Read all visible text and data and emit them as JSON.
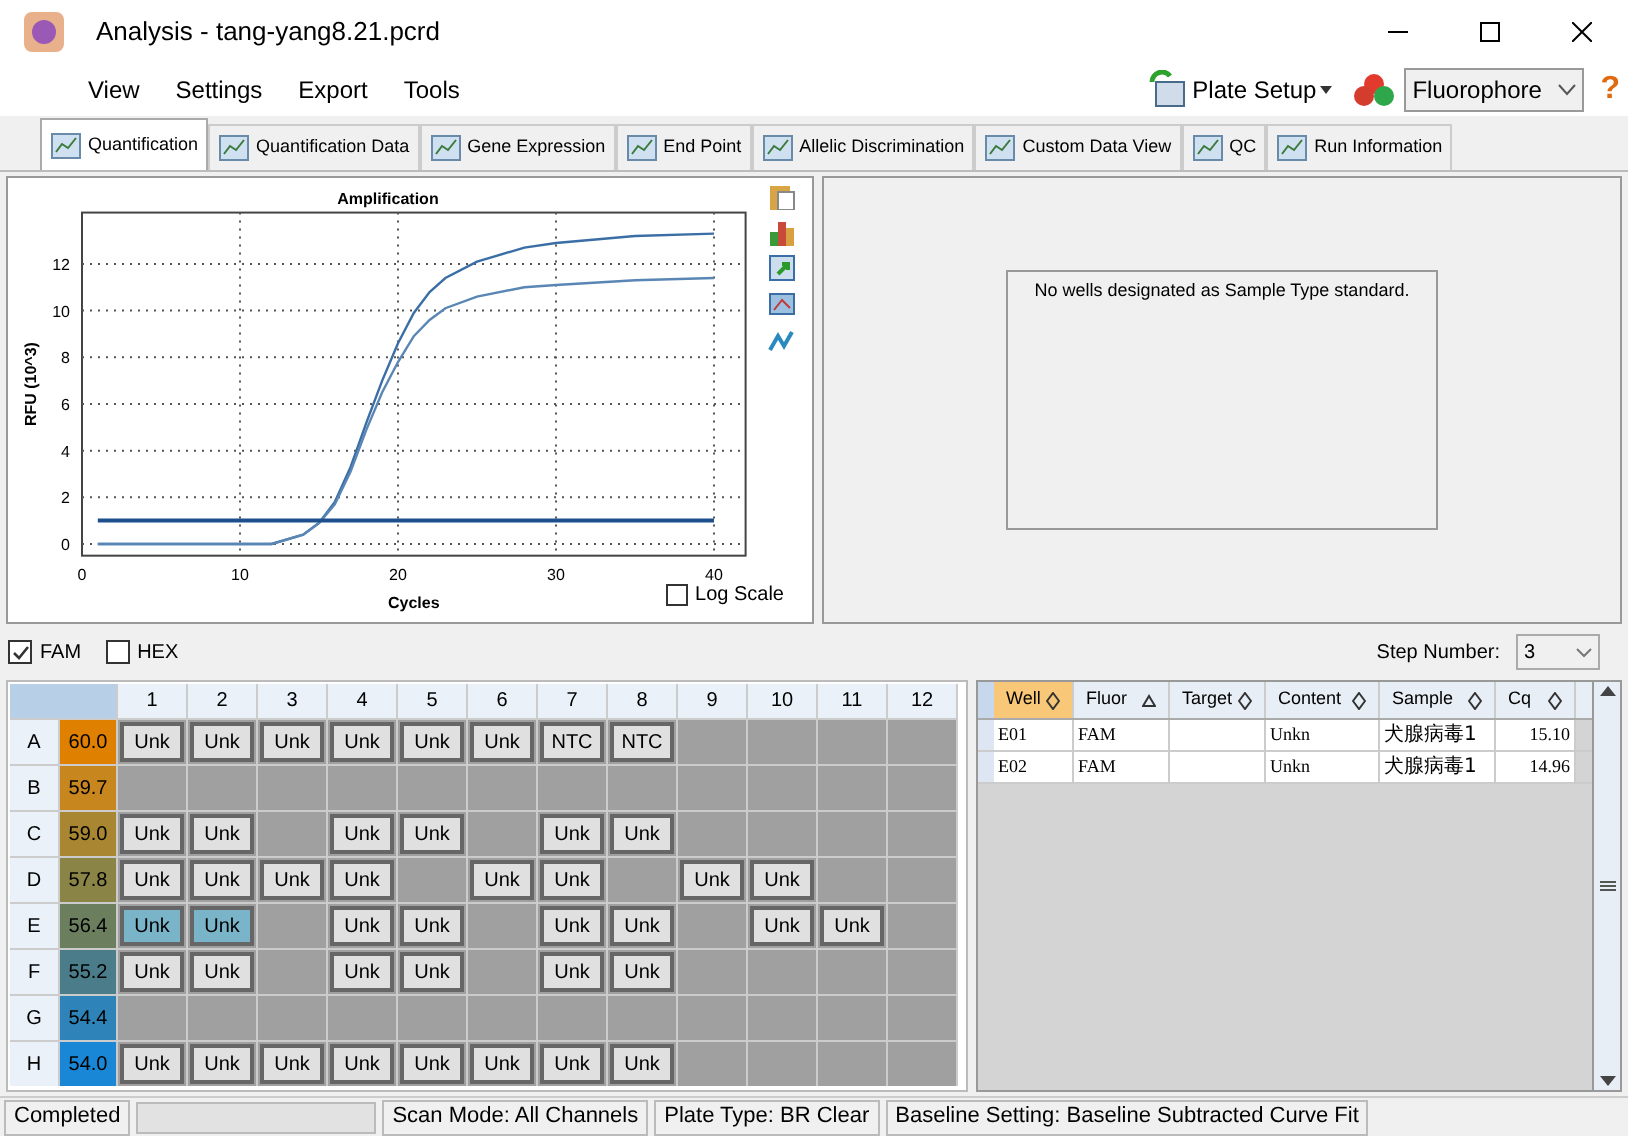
{
  "window": {
    "title": "Analysis - tang-yang8.21.pcrd"
  },
  "menu": [
    "View",
    "Settings",
    "Export",
    "Tools"
  ],
  "toolbar": {
    "plate_setup": "Plate Setup",
    "fluorophore": "Fluorophore",
    "help": "?"
  },
  "tabs": [
    {
      "label": "Quantification",
      "selected": true
    },
    {
      "label": "Quantification Data",
      "selected": false
    },
    {
      "label": "Gene Expression",
      "selected": false
    },
    {
      "label": "End Point",
      "selected": false
    },
    {
      "label": "Allelic Discrimination",
      "selected": false
    },
    {
      "label": "Custom Data View",
      "selected": false
    },
    {
      "label": "QC",
      "selected": false
    },
    {
      "label": "Run Information",
      "selected": false
    }
  ],
  "chart": {
    "log_scale": {
      "label": "Log Scale",
      "checked": false
    },
    "chart_data": {
      "type": "line",
      "title": "Amplification",
      "xlabel": "Cycles",
      "ylabel": "RFU (10^3)",
      "xlim": [
        0,
        42
      ],
      "ylim": [
        -0.5,
        14.2
      ],
      "xticks": [
        0,
        10,
        20,
        30,
        40
      ],
      "yticks": [
        0,
        2,
        4,
        6,
        8,
        10,
        12
      ],
      "grid": true,
      "x": [
        1,
        5,
        10,
        12,
        14,
        15,
        16,
        17,
        18,
        19,
        20,
        21,
        22,
        23,
        25,
        28,
        30,
        35,
        40
      ],
      "series": [
        {
          "color": "#3a6ea5",
          "values": [
            0,
            0,
            0,
            0,
            0.4,
            0.9,
            1.8,
            3.3,
            5.2,
            7.0,
            8.6,
            9.9,
            10.8,
            11.4,
            12.1,
            12.7,
            12.9,
            13.2,
            13.3
          ]
        },
        {
          "color": "#5a86b5",
          "values": [
            0,
            0,
            0,
            0,
            0.4,
            0.9,
            1.7,
            3.1,
            4.9,
            6.5,
            7.8,
            8.9,
            9.6,
            10.1,
            10.6,
            11.0,
            11.1,
            11.3,
            11.4
          ]
        },
        {
          "color": "#1c4f8c",
          "values": [
            1,
            1,
            1,
            1,
            1,
            1,
            1,
            1,
            1,
            1,
            1,
            1,
            1,
            1,
            1,
            1,
            1,
            1,
            1
          ]
        }
      ]
    }
  },
  "standard_message": "No wells designated as Sample Type standard.",
  "fluors": [
    {
      "label": "FAM",
      "checked": true
    },
    {
      "label": "HEX",
      "checked": false
    }
  ],
  "step": {
    "label": "Step Number:",
    "value": "3"
  },
  "plate": {
    "columns": [
      "1",
      "2",
      "3",
      "4",
      "5",
      "6",
      "7",
      "8",
      "9",
      "10",
      "11",
      "12"
    ],
    "rows": [
      {
        "label": "A",
        "temp": "60.0",
        "color": "#e08000",
        "wells": [
          {
            "kind": "sample",
            "label": "Unk",
            "selected": false
          },
          {
            "kind": "sample",
            "label": "Unk",
            "selected": false
          },
          {
            "kind": "sample",
            "label": "Unk",
            "selected": false
          },
          {
            "kind": "sample",
            "label": "Unk",
            "selected": false
          },
          {
            "kind": "sample",
            "label": "Unk",
            "selected": false
          },
          {
            "kind": "sample",
            "label": "Unk",
            "selected": false
          },
          {
            "kind": "sample",
            "label": "NTC",
            "selected": false
          },
          {
            "kind": "sample",
            "label": "NTC",
            "selected": false
          },
          {
            "kind": "empty"
          },
          {
            "kind": "empty"
          },
          {
            "kind": "empty"
          },
          {
            "kind": "empty"
          }
        ]
      },
      {
        "label": "B",
        "temp": "59.7",
        "color": "#c8861e",
        "wells": [
          {
            "kind": "empty"
          },
          {
            "kind": "empty"
          },
          {
            "kind": "empty"
          },
          {
            "kind": "empty"
          },
          {
            "kind": "empty"
          },
          {
            "kind": "empty"
          },
          {
            "kind": "empty"
          },
          {
            "kind": "empty"
          },
          {
            "kind": "empty"
          },
          {
            "kind": "empty"
          },
          {
            "kind": "empty"
          },
          {
            "kind": "empty"
          }
        ]
      },
      {
        "label": "C",
        "temp": "59.0",
        "color": "#a98632",
        "wells": [
          {
            "kind": "sample",
            "label": "Unk",
            "selected": false
          },
          {
            "kind": "sample",
            "label": "Unk",
            "selected": false
          },
          {
            "kind": "empty"
          },
          {
            "kind": "sample",
            "label": "Unk",
            "selected": false
          },
          {
            "kind": "sample",
            "label": "Unk",
            "selected": false
          },
          {
            "kind": "empty"
          },
          {
            "kind": "sample",
            "label": "Unk",
            "selected": false
          },
          {
            "kind": "sample",
            "label": "Unk",
            "selected": false
          },
          {
            "kind": "empty"
          },
          {
            "kind": "empty"
          },
          {
            "kind": "empty"
          },
          {
            "kind": "empty"
          }
        ]
      },
      {
        "label": "D",
        "temp": "57.8",
        "color": "#8a8446",
        "wells": [
          {
            "kind": "sample",
            "label": "Unk",
            "selected": false
          },
          {
            "kind": "sample",
            "label": "Unk",
            "selected": false
          },
          {
            "kind": "sample",
            "label": "Unk",
            "selected": false
          },
          {
            "kind": "sample",
            "label": "Unk",
            "selected": false
          },
          {
            "kind": "empty"
          },
          {
            "kind": "sample",
            "label": "Unk",
            "selected": false
          },
          {
            "kind": "sample",
            "label": "Unk",
            "selected": false
          },
          {
            "kind": "empty"
          },
          {
            "kind": "sample",
            "label": "Unk",
            "selected": false
          },
          {
            "kind": "sample",
            "label": "Unk",
            "selected": false
          },
          {
            "kind": "empty"
          },
          {
            "kind": "empty"
          }
        ]
      },
      {
        "label": "E",
        "temp": "56.4",
        "color": "#6b7f5e",
        "wells": [
          {
            "kind": "sample",
            "label": "Unk",
            "selected": true
          },
          {
            "kind": "sample",
            "label": "Unk",
            "selected": true
          },
          {
            "kind": "empty"
          },
          {
            "kind": "sample",
            "label": "Unk",
            "selected": false
          },
          {
            "kind": "sample",
            "label": "Unk",
            "selected": false
          },
          {
            "kind": "empty"
          },
          {
            "kind": "sample",
            "label": "Unk",
            "selected": false
          },
          {
            "kind": "sample",
            "label": "Unk",
            "selected": false
          },
          {
            "kind": "empty"
          },
          {
            "kind": "sample",
            "label": "Unk",
            "selected": false
          },
          {
            "kind": "sample",
            "label": "Unk",
            "selected": false
          },
          {
            "kind": "empty"
          }
        ]
      },
      {
        "label": "F",
        "temp": "55.2",
        "color": "#4a7c8a",
        "wells": [
          {
            "kind": "sample",
            "label": "Unk",
            "selected": false
          },
          {
            "kind": "sample",
            "label": "Unk",
            "selected": false
          },
          {
            "kind": "empty"
          },
          {
            "kind": "sample",
            "label": "Unk",
            "selected": false
          },
          {
            "kind": "sample",
            "label": "Unk",
            "selected": false
          },
          {
            "kind": "empty"
          },
          {
            "kind": "sample",
            "label": "Unk",
            "selected": false
          },
          {
            "kind": "sample",
            "label": "Unk",
            "selected": false
          },
          {
            "kind": "empty"
          },
          {
            "kind": "empty"
          },
          {
            "kind": "empty"
          },
          {
            "kind": "empty"
          }
        ]
      },
      {
        "label": "G",
        "temp": "54.4",
        "color": "#2e84b8",
        "wells": [
          {
            "kind": "empty"
          },
          {
            "kind": "empty"
          },
          {
            "kind": "empty"
          },
          {
            "kind": "empty"
          },
          {
            "kind": "empty"
          },
          {
            "kind": "empty"
          },
          {
            "kind": "empty"
          },
          {
            "kind": "empty"
          },
          {
            "kind": "empty"
          },
          {
            "kind": "empty"
          },
          {
            "kind": "empty"
          },
          {
            "kind": "empty"
          }
        ]
      },
      {
        "label": "H",
        "temp": "54.0",
        "color": "#1a86d6",
        "wells": [
          {
            "kind": "sample",
            "label": "Unk",
            "selected": false
          },
          {
            "kind": "sample",
            "label": "Unk",
            "selected": false
          },
          {
            "kind": "sample",
            "label": "Unk",
            "selected": false
          },
          {
            "kind": "sample",
            "label": "Unk",
            "selected": false
          },
          {
            "kind": "sample",
            "label": "Unk",
            "selected": false
          },
          {
            "kind": "sample",
            "label": "Unk",
            "selected": false
          },
          {
            "kind": "sample",
            "label": "Unk",
            "selected": false
          },
          {
            "kind": "sample",
            "label": "Unk",
            "selected": false
          },
          {
            "kind": "empty"
          },
          {
            "kind": "empty"
          },
          {
            "kind": "empty"
          },
          {
            "kind": "empty"
          }
        ]
      }
    ]
  },
  "table": {
    "columns": [
      {
        "label": "Well",
        "sort_ascending": false,
        "selected": true
      },
      {
        "label": "Fluor",
        "sort_ascending": true,
        "selected": false
      },
      {
        "label": "Target",
        "sort_ascending": false,
        "selected": false
      },
      {
        "label": "Content",
        "sort_ascending": false,
        "selected": false
      },
      {
        "label": "Sample",
        "sort_ascending": false,
        "selected": false
      },
      {
        "label": "Cq",
        "sort_ascending": false,
        "selected": false
      }
    ],
    "rows": [
      {
        "well": "E01",
        "fluor": "FAM",
        "content": "Unkn",
        "sample": "犬腺病毒1",
        "cq": "15.10"
      },
      {
        "well": "E02",
        "fluor": "FAM",
        "content": "Unkn",
        "sample": "犬腺病毒1",
        "cq": "14.96"
      }
    ]
  },
  "status_bar": {
    "items": [
      "Completed",
      "Scan Mode: All Channels",
      "Plate Type: BR Clear",
      "Baseline Setting: Baseline Subtracted Curve Fit"
    ],
    "progress": {
      "level": 0
    }
  }
}
